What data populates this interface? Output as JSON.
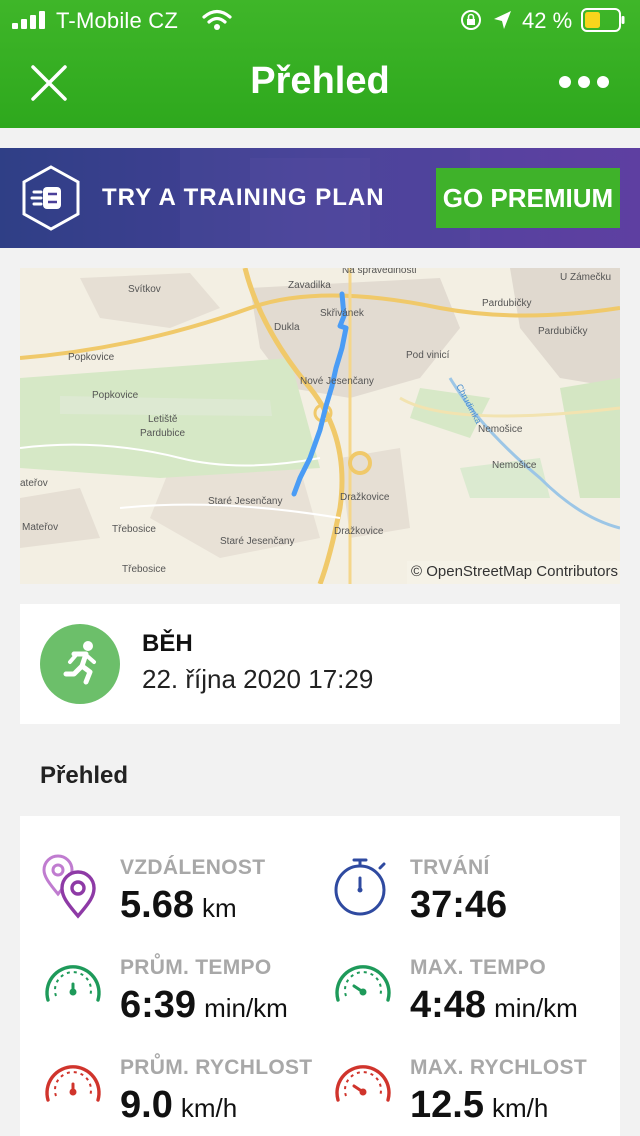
{
  "status_bar": {
    "carrier": "T-Mobile CZ",
    "battery_percent": "42 %",
    "icons": [
      "signal-icon",
      "wifi-icon",
      "rotation-lock-icon",
      "location-icon",
      "battery-icon"
    ]
  },
  "nav": {
    "title": "Přehled",
    "close_icon": "close-icon",
    "more_icon": "more-icon"
  },
  "banner": {
    "text": "TRY A TRAINING PLAN",
    "button_label": "GO PREMIUM",
    "icon": "training-plan-icon"
  },
  "map": {
    "attribution": "© OpenStreetMap Contributors",
    "places": [
      "Na spravedlnosti",
      "U Zámečku",
      "Svítkov",
      "Zavadilka",
      "Pardubičky",
      "Skřivánek",
      "Pardubičky",
      "Dukla",
      "Popkovice",
      "Pod vinicí",
      "Nové Jesenčany",
      "Popkovice",
      "Chrudimka",
      "Letiště",
      "Pardubice",
      "Nemošice",
      "Nemošice",
      "ateřov",
      "Staré Jesenčany",
      "Dražkovice",
      "Mateřov",
      "Třebosice",
      "Dražkovice",
      "Staré Jesenčany",
      "Třebosice"
    ]
  },
  "activity": {
    "type": "BĚH",
    "date": "22. října 2020 17:29",
    "icon": "running-icon"
  },
  "section_title": "Přehled",
  "stats": [
    {
      "label": "VZDÁLENOST",
      "value": "5.68",
      "unit": "km",
      "icon": "distance-pin-icon"
    },
    {
      "label": "TRVÁNÍ",
      "value": "37:46",
      "unit": "",
      "icon": "stopwatch-icon"
    },
    {
      "label": "PRŮM. TEMPO",
      "value": "6:39",
      "unit": "min/km",
      "icon": "avg-pace-gauge-icon"
    },
    {
      "label": "MAX. TEMPO",
      "value": "4:48",
      "unit": "min/km",
      "icon": "max-pace-gauge-icon"
    },
    {
      "label": "PRŮM. RYCHLOST",
      "value": "9.0",
      "unit": "km/h",
      "icon": "avg-speed-gauge-icon"
    },
    {
      "label": "MAX. RYCHLOST",
      "value": "12.5",
      "unit": "km/h",
      "icon": "max-speed-gauge-icon"
    }
  ],
  "colors": {
    "header_green": "#2ea81d",
    "premium_green": "#3fb22a",
    "banner_purple": "#4a3f99",
    "route_blue": "#4a9cf5",
    "distance_purple": "#8e3aa6",
    "duration_blue": "#2f4aa0",
    "pace_green": "#1e9a5a",
    "speed_red": "#d0342c",
    "activity_green": "#6cbf6a"
  }
}
